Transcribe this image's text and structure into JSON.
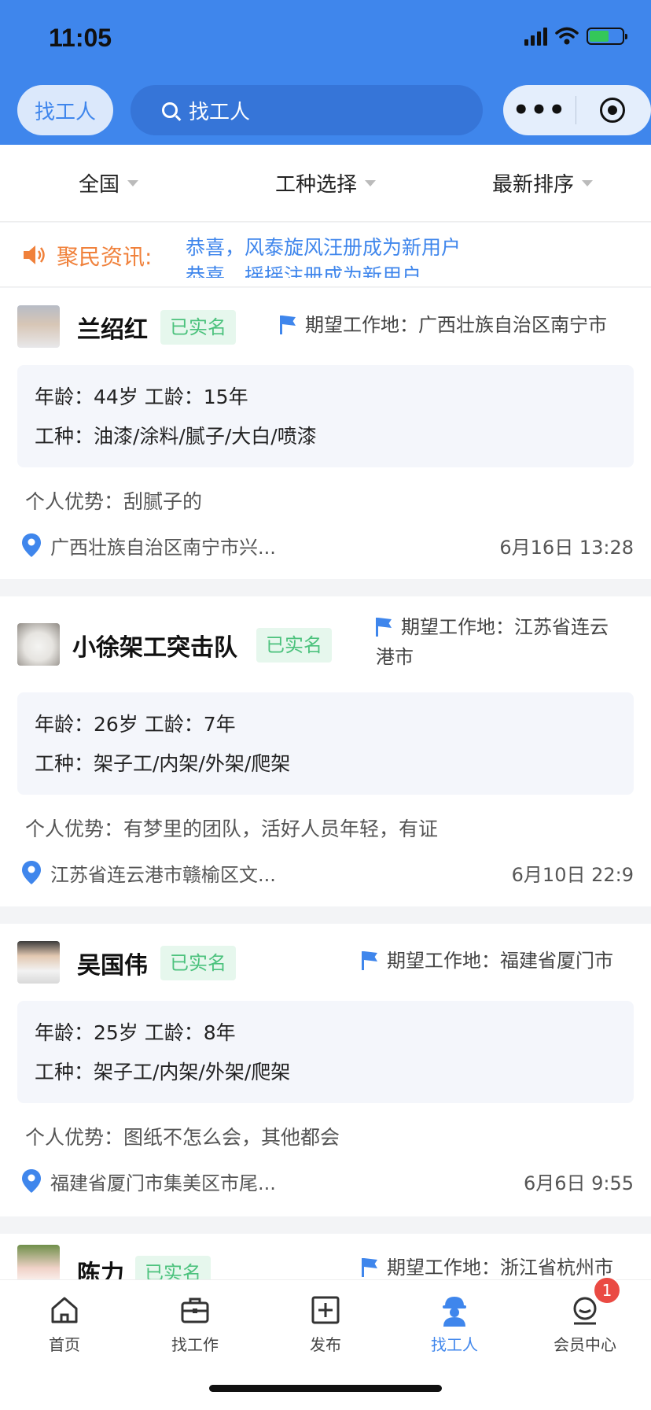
{
  "status_bar": {
    "time": "11:05"
  },
  "header": {
    "left_pill": "找工人",
    "search_text": "找工人"
  },
  "filters": [
    {
      "label": "全国"
    },
    {
      "label": "工种选择"
    },
    {
      "label": "最新排序"
    }
  ],
  "notice": {
    "label": "聚民资讯:",
    "lines": [
      "恭喜，风泰旋风汪册成为新用户",
      "恭喜，摇摇注册成为新用户"
    ]
  },
  "workers": [
    {
      "name": "兰绍红",
      "verified": "已实名",
      "expect_line1": "期望工作地：广西壮族自治区南宁市",
      "expect_line2": "",
      "age_exp": "年龄：44岁 工龄：15年",
      "trade": "工种：油漆/涂料/腻子/大白/喷漆",
      "advantage": "个人优势：刮腻子的",
      "location": "广西壮族自治区南宁市兴...",
      "date": "6月16日 13:28"
    },
    {
      "name": "小徐架工突击队",
      "verified": "已实名",
      "expect_line1": "期望工作地：江苏省连云",
      "expect_line2": "港市",
      "age_exp": "年龄：26岁 工龄：7年",
      "trade": "工种：架子工/内架/外架/爬架",
      "advantage": "个人优势：有梦里的团队，活好人员年轻，有证",
      "location": "江苏省连云港市赣榆区文...",
      "date": "6月10日 22:9"
    },
    {
      "name": "吴国伟",
      "verified": "已实名",
      "expect_line1": "期望工作地：福建省厦门市",
      "expect_line2": "",
      "age_exp": "年龄：25岁 工龄：8年",
      "trade": "工种：架子工/内架/外架/爬架",
      "advantage": "个人优势：图纸不怎么会，其他都会",
      "location": "福建省厦门市集美区市尾...",
      "date": "6月6日 9:55"
    },
    {
      "name": "陈力",
      "verified": "已实名",
      "expect_line1": "期望工作地：浙江省杭州市"
    }
  ],
  "tabs": [
    {
      "label": "首页",
      "icon": "home-icon"
    },
    {
      "label": "找工作",
      "icon": "briefcase-icon"
    },
    {
      "label": "发布",
      "icon": "plus-square-icon"
    },
    {
      "label": "找工人",
      "icon": "worker-icon"
    },
    {
      "label": "会员中心",
      "icon": "member-icon"
    }
  ],
  "member_badge": "1",
  "colors": {
    "brand_blue": "#3f86ec",
    "verified_green": "#4cc27d",
    "notice_orange": "#f0813b",
    "badge_red": "#ea4a43"
  }
}
